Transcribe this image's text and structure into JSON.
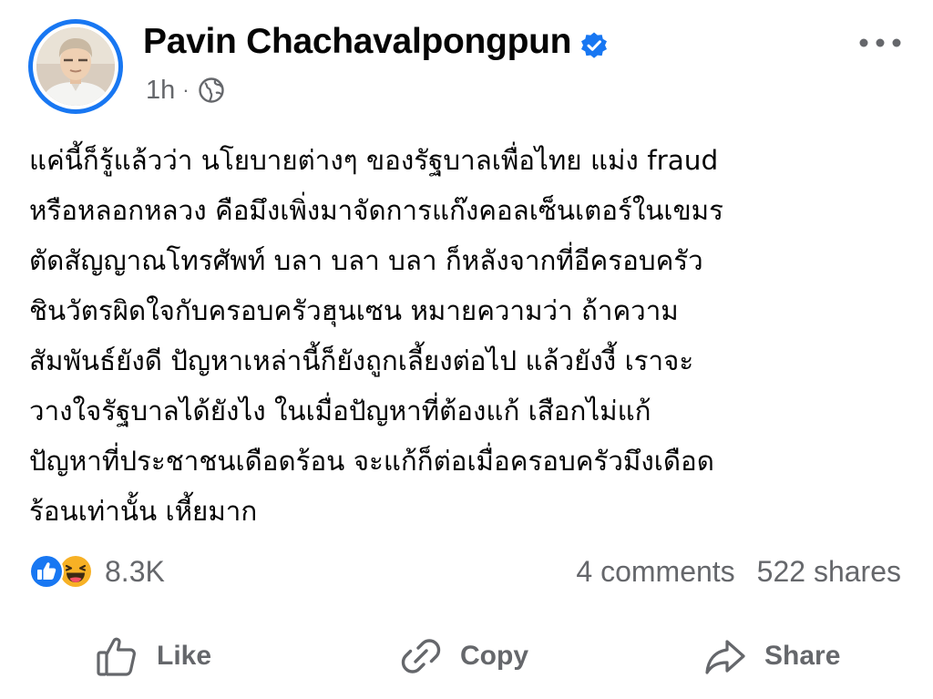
{
  "post": {
    "author": "Pavin Chachavalpongpun",
    "timestamp": "1h",
    "separator": "·",
    "text_lines": [
      "แค่นี้ก็รู้แล้วว่า นโยบายต่างๆ ของรัฐบาลเพื่อไทย แม่ง fraud",
      "หรือหลอกหลวง คือมึงเพิ่งมาจัดการแก๊งคอลเซ็นเตอร์ในเขมร",
      "ตัดสัญญาณโทรศัพท์ บลา บลา บลา ก็หลังจากที่อีครอบครัว",
      "ชินวัตรผิดใจกับครอบครัวฮุนเซน หมายความว่า ถ้าความ",
      "สัมพันธ์ยังดี ปัญหาเหล่านี้ก็ยังถูกเลี้ยงต่อไป แล้วยังงี้ เราจะ",
      "วางใจรัฐบาลได้ยังไง ในเมื่อปัญหาที่ต้องแก้ เสือกไม่แก้",
      "ปัญหาที่ประชาชนเดือดร้อน จะแก้ก็ต่อเมื่อครอบครัวมึงเดือด",
      "ร้อนเท่านั้น เหี้ยมาก"
    ]
  },
  "reactions": {
    "icons": [
      "like-reaction-icon",
      "haha-reaction-icon"
    ],
    "count": "8.3K",
    "comments": "4 comments",
    "shares": "522 shares"
  },
  "actions": {
    "like_label": "Like",
    "copy_label": "Copy",
    "share_label": "Share"
  },
  "colors": {
    "brand_blue": "#1877f2",
    "secondary_text": "#65676b",
    "primary_text": "#050505",
    "haha_yellow": "#f7b125"
  }
}
